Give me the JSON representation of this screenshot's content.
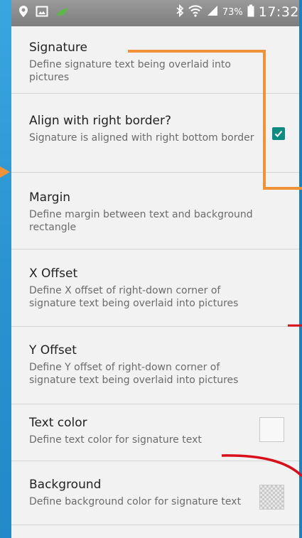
{
  "status_bar": {
    "battery_percent": "73%",
    "time": "17:32"
  },
  "preferences": [
    {
      "title": "Signature",
      "summary": "Define signature text being overlaid into pictures"
    },
    {
      "title": "Align with right border?",
      "summary": "Signature is aligned with right bottom border",
      "checked": true
    },
    {
      "title": "Margin",
      "summary": "Define margin between text and background rectangle"
    },
    {
      "title": "X Offset",
      "summary": "Define X offset of right-down corner of signature text being overlaid into pictures"
    },
    {
      "title": "Y Offset",
      "summary": "Define Y offset of right-down corner of signature text being overlaid into pictures"
    },
    {
      "title": "Text color",
      "summary": "Define text color for signature text"
    },
    {
      "title": "Background",
      "summary": "Define background color for signature text"
    }
  ],
  "colors": {
    "checkbox": "#0e8c84",
    "annotation_orange": "#f0923a",
    "annotation_red": "#d8101a"
  }
}
